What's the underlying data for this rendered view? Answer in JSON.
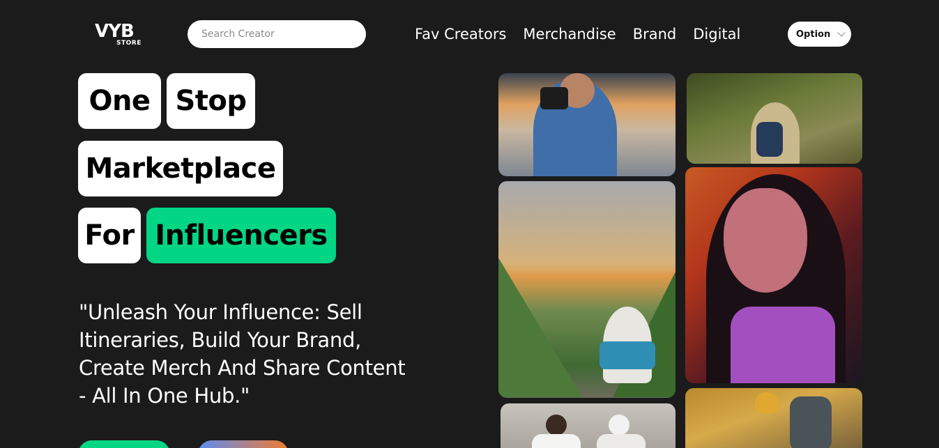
{
  "header": {
    "logo_main": "VYB",
    "logo_sub": "STORE",
    "search_placeholder": "Search Creator",
    "nav": [
      "Fav Creators",
      "Merchandise",
      "Brand",
      "Digital"
    ],
    "option_label": "Option"
  },
  "hero": {
    "words": [
      "One",
      "Stop",
      "Marketplace",
      "For",
      "Influencers"
    ],
    "tagline": "\"Unleash Your Influence: Sell Itineraries, Build Your Brand, Create Merch And Share Content - All In One Hub.\""
  },
  "colors": {
    "background": "#1b1b1b",
    "accent": "#02d684",
    "text": "#ffffff"
  },
  "icons": {
    "option_dropdown": "chevron-down-icon"
  }
}
